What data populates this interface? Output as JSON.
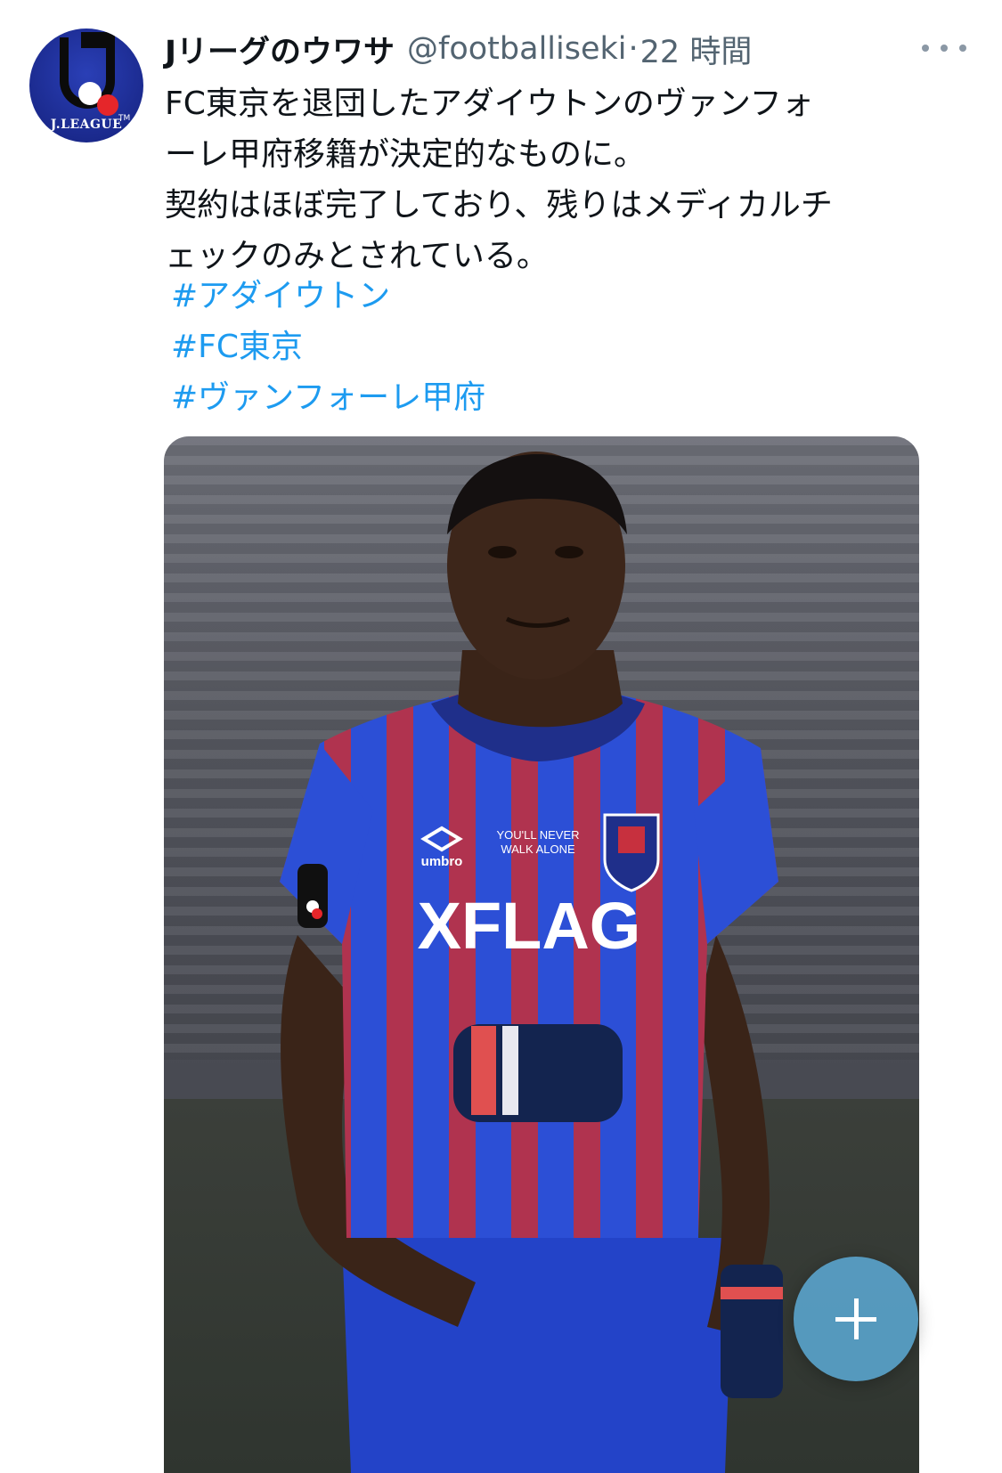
{
  "tweet": {
    "author_name": "Jリーグのウワサ",
    "handle": "@footballiseki",
    "separator": "·",
    "time": "22 時間",
    "avatar_label": "J.LEAGUE",
    "body_lines": [
      "FC東京を退団したアダイウトンのヴァンフォ",
      "ーレ甲府移籍が決定的なものに。",
      "契約はほぼ完了しており、残りはメディカルチ",
      "ェックのみとされている。"
    ],
    "hashtags": [
      "#アダイウトン",
      "#FC東京",
      "#ヴァンフォーレ甲府"
    ],
    "media": {
      "jersey_text": "XFLAG",
      "jersey_brand": "umbro",
      "jersey_slogan_1": "YOU'LL NEVER",
      "jersey_slogan_2": "WALK ALONE"
    }
  },
  "fab": {
    "icon": "plus-icon"
  },
  "colors": {
    "link": "#1d9bf0",
    "secondary_text": "#536471",
    "jersey_blue": "#2c4fd6",
    "jersey_red": "#b0334f"
  }
}
